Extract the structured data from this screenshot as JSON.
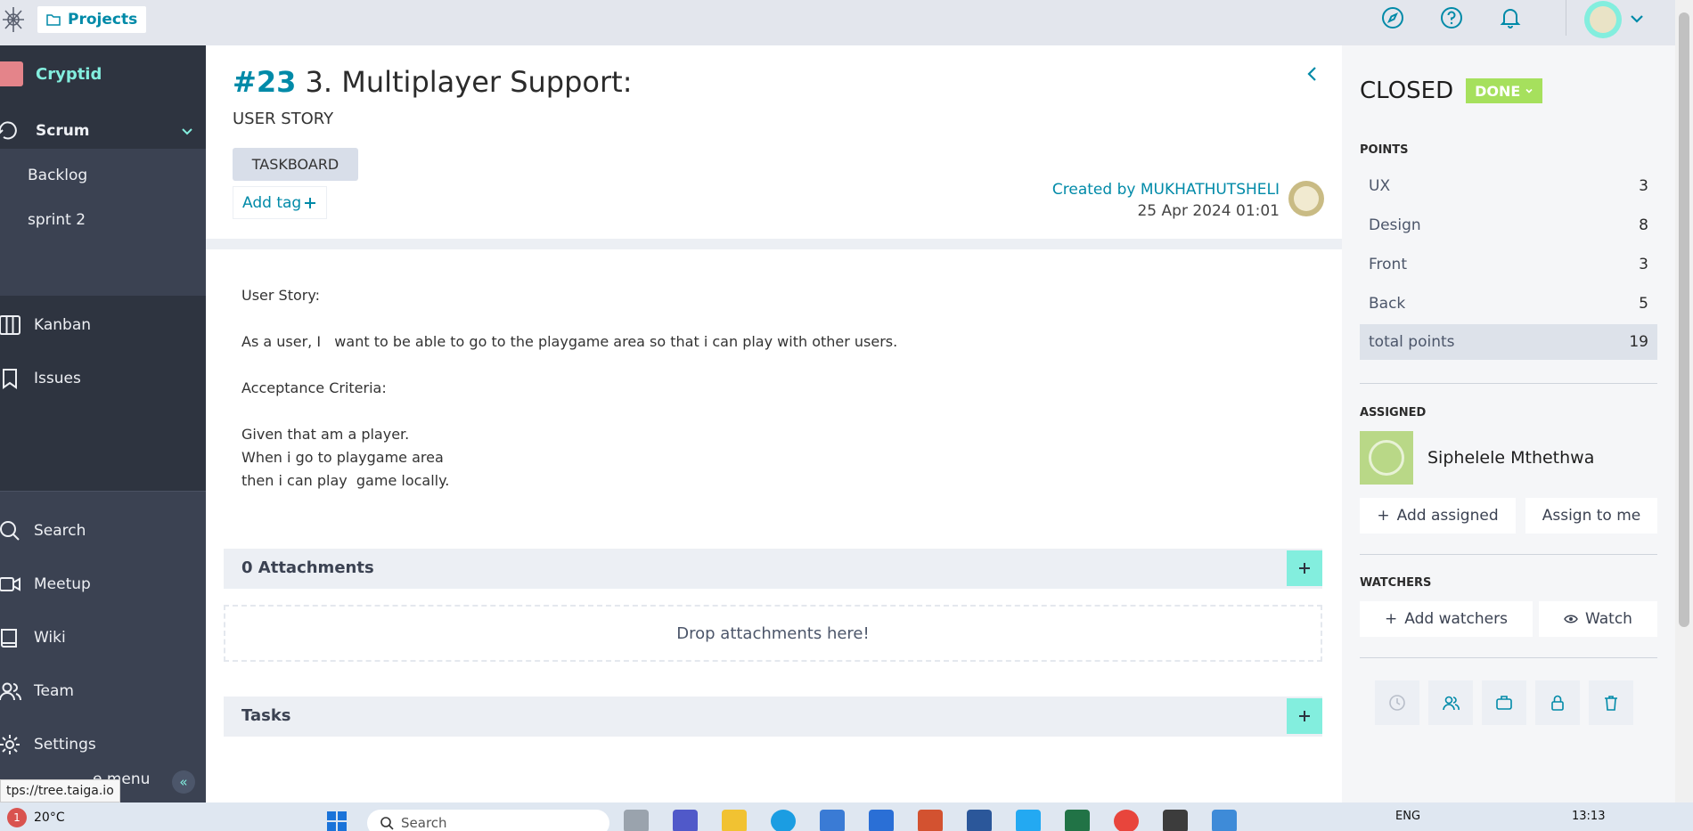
{
  "topbar": {
    "projects_label": "Projects",
    "icons": [
      "compass-icon",
      "help-icon",
      "bell-icon",
      "chevron-down-icon"
    ]
  },
  "sidebar": {
    "project_name": "Cryptid",
    "scrum_label": "Scrum",
    "scrum_items": [
      {
        "label": "Backlog"
      },
      {
        "label": "sprint 2"
      }
    ],
    "items": [
      {
        "label": "Kanban",
        "icon": "kanban-icon"
      },
      {
        "label": "Issues",
        "icon": "bookmark-icon"
      }
    ],
    "lower_items": [
      {
        "label": "Search",
        "icon": "search-icon"
      },
      {
        "label": "Meetup",
        "icon": "video-icon"
      },
      {
        "label": "Wiki",
        "icon": "book-icon"
      },
      {
        "label": "Team",
        "icon": "team-icon"
      },
      {
        "label": "Settings",
        "icon": "gear-icon"
      }
    ],
    "collapse_label": "e menu"
  },
  "story": {
    "ref": "#23",
    "title": "3. Multiplayer Support:",
    "type": "USER STORY",
    "taskboard_label": "TASKBOARD",
    "add_tag_label": "Add tag",
    "created_by": "Created by MUKHATHUTSHELI",
    "created_date": "25 Apr 2024 01:01",
    "description": "User Story:\n\nAs a user, I   want to be able to go to the playgame area so that i can play with other users.\n\nAcceptance Criteria:\n\nGiven that am a player.\nWhen i go to playgame area\nthen i can play  game locally.",
    "attachments_title": "0 Attachments",
    "drop_label": "Drop attachments here!",
    "tasks_title": "Tasks"
  },
  "right_panel": {
    "status": "CLOSED",
    "status_badge": "DONE",
    "points_label": "POINTS",
    "points": [
      {
        "name": "UX",
        "value": "3"
      },
      {
        "name": "Design",
        "value": "8"
      },
      {
        "name": "Front",
        "value": "3"
      },
      {
        "name": "Back",
        "value": "5"
      }
    ],
    "total_label": "total points",
    "total_value": "19",
    "assigned_label": "ASSIGNED",
    "assignee_name": "Siphelele Mthethwa",
    "add_assigned_label": "Add assigned",
    "assign_me_label": "Assign to me",
    "watchers_label": "WATCHERS",
    "add_watchers_label": "Add watchers",
    "watch_label": "Watch",
    "action_icons": [
      "clock-icon",
      "team-icon",
      "briefcase-icon",
      "lock-icon",
      "trash-icon"
    ]
  },
  "status_url": "tps://tree.taiga.io",
  "taskbar": {
    "weather_badge": "1",
    "weather_temp": "20°C",
    "search_label": "Search",
    "lang": "ENG",
    "time": "13:13"
  },
  "colors": {
    "accent": "#008aa8",
    "sidebar_bg": "#2e3440",
    "teal": "#83eede",
    "done": "#a6e05d"
  }
}
